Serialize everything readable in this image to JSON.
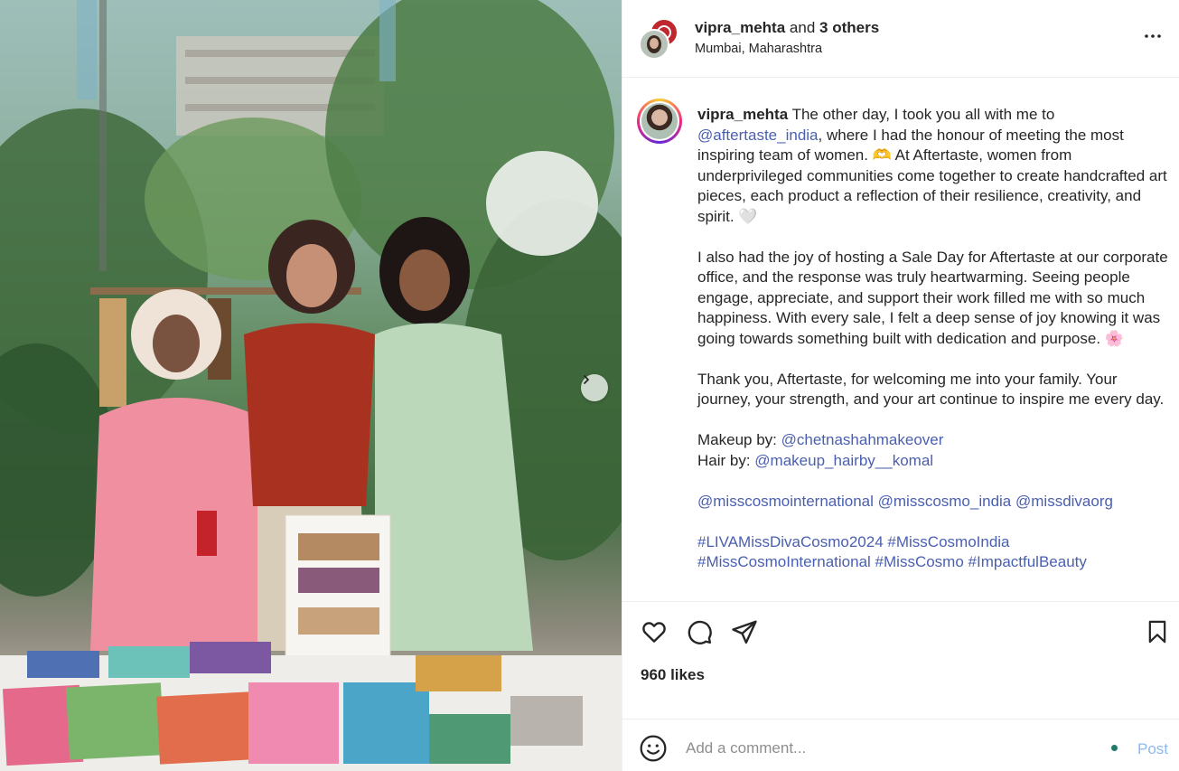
{
  "header": {
    "username": "vipra_mehta",
    "and_text": "and",
    "others": "3 others",
    "location": "Mumbai, Maharashtra"
  },
  "caption": {
    "username": "vipra_mehta",
    "p1_text1": " The other day, I took you all with me to ",
    "p1_mention": "@aftertaste_india",
    "p1_text2": ", where I had the honour of meeting the most inspiring team of women. 🫶 At Aftertaste, women from underprivileged communities come together to create handcrafted art pieces, each product a reflection of their resilience, creativity, and spirit. 🤍",
    "p2": "I also had the joy of hosting a Sale Day for Aftertaste at our corporate office, and the response was truly heartwarming. Seeing people engage, appreciate, and support their work filled me with so much happiness. With every sale, I felt a deep sense of joy knowing it was going towards something built with dedication and purpose. 🌸",
    "p3": "Thank you, Aftertaste, for welcoming me into your family. Your journey, your strength, and your art continue to inspire me every day.",
    "makeup_label": "Makeup by: ",
    "makeup_mention": "@chetnashahmakeover",
    "hair_label": "Hair by: ",
    "hair_mention": "@makeup_hairby__komal",
    "mentions": [
      "@misscosmointernational",
      "@misscosmo_india",
      "@missdivaorg"
    ],
    "hashtags_line1": [
      "#LIVAMissDivaCosmo2024",
      "#MissCosmoIndia"
    ],
    "hashtags_line2": [
      "#MissCosmoInternational",
      "#MissCosmo",
      "#ImpactfulBeauty"
    ]
  },
  "likes": "960 likes",
  "comment": {
    "placeholder": "Add a comment...",
    "post_label": "Post"
  },
  "icons": [
    "more-options-icon",
    "heart-icon",
    "comment-icon",
    "share-icon",
    "bookmark-icon",
    "emoji-icon",
    "chevron-right-icon"
  ],
  "colors": {
    "mention": "#4a5fb0",
    "post_disabled": "#8fb8ef",
    "divider": "#efefef"
  }
}
